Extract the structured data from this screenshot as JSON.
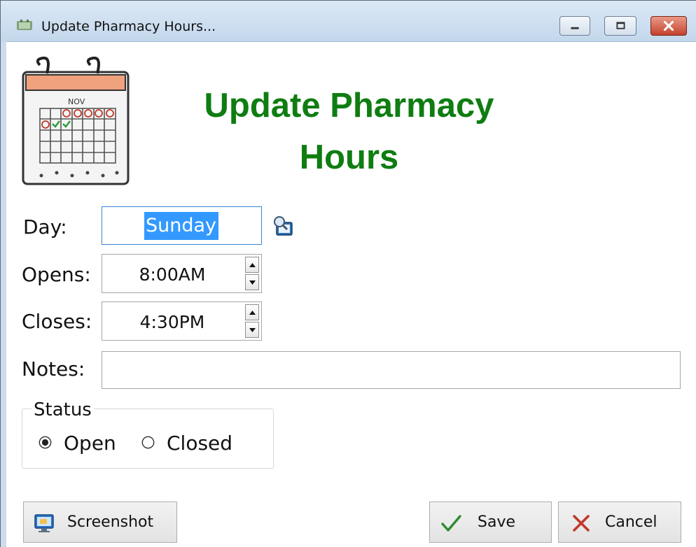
{
  "window": {
    "title": "Update Pharmacy Hours...",
    "controls": {
      "minimize": "minimize",
      "maximize": "maximize",
      "close": "close"
    }
  },
  "header": {
    "title_line1": "Update Pharmacy",
    "title_line2": "Hours",
    "calendar_month": "NOV",
    "accent_color": "#0f7d12"
  },
  "form": {
    "day": {
      "label": "Day:",
      "value": "Sunday",
      "lookup_icon": "lookup-icon"
    },
    "opens": {
      "label": "Opens:",
      "value": "8:00AM"
    },
    "closes": {
      "label": "Closes:",
      "value": "4:30PM"
    },
    "notes": {
      "label": "Notes:",
      "value": ""
    }
  },
  "status": {
    "legend": "Status",
    "options": [
      {
        "label": "Open",
        "selected": true
      },
      {
        "label": "Closed",
        "selected": false
      }
    ]
  },
  "buttons": {
    "screenshot": "Screenshot",
    "save": "Save",
    "cancel": "Cancel"
  }
}
